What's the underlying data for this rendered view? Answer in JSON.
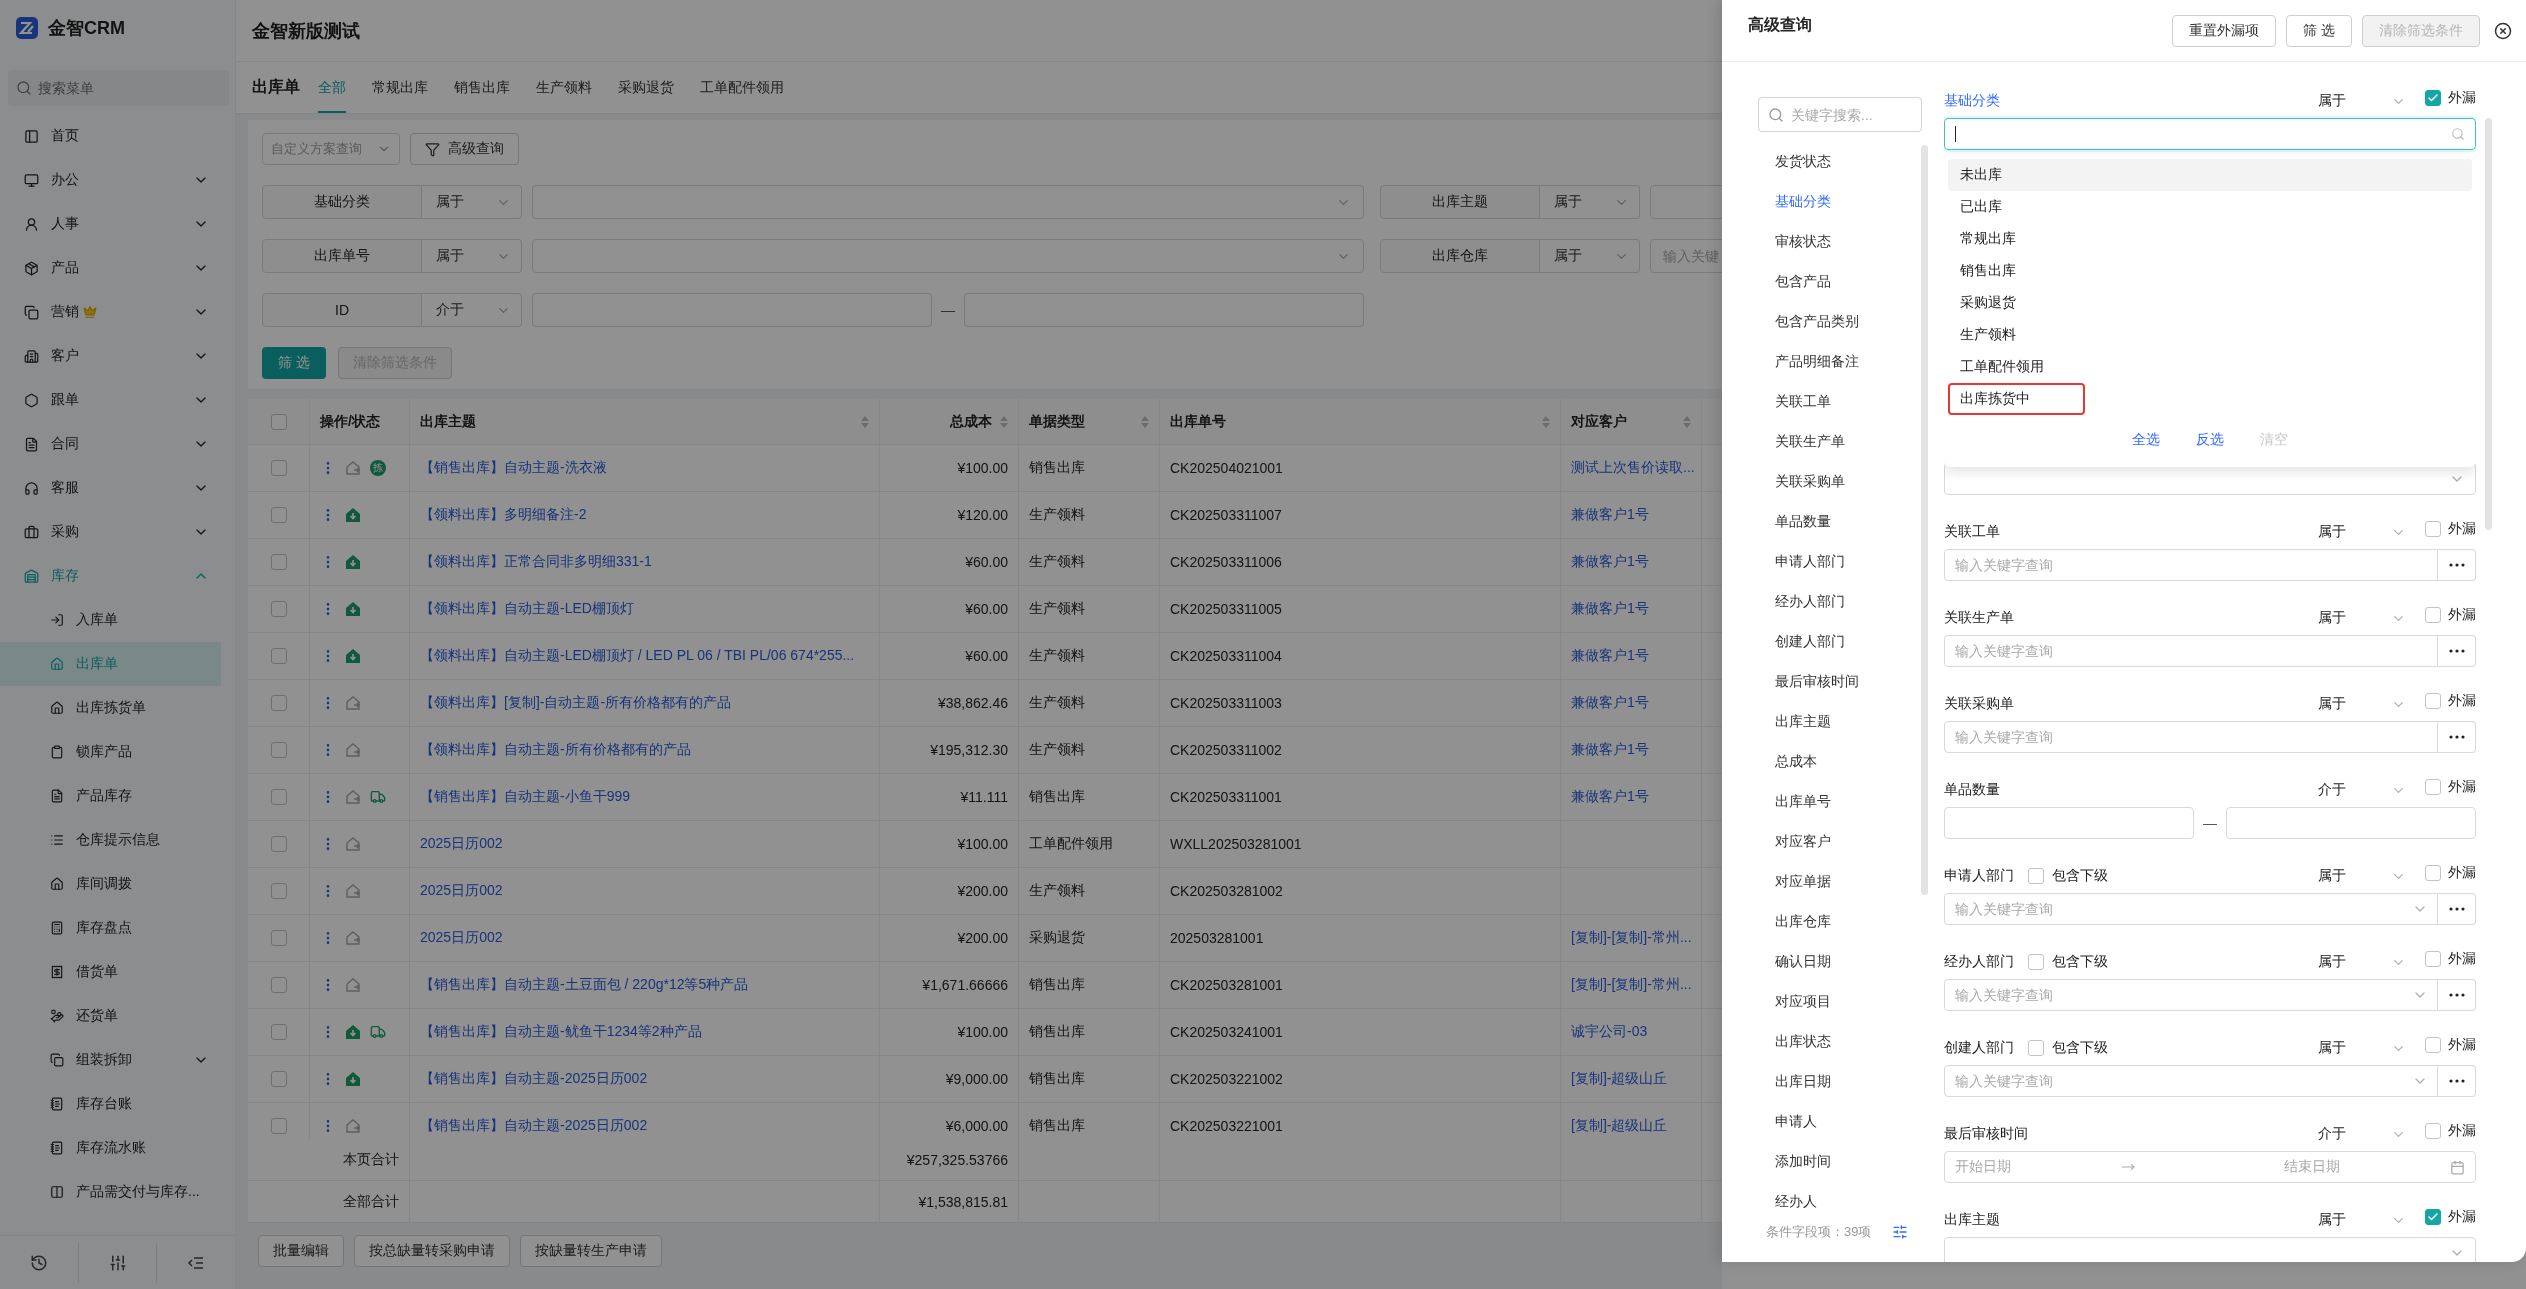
{
  "sidebar": {
    "brand": "金智CRM",
    "search_placeholder": "搜索菜单",
    "items": [
      {
        "label": "首页",
        "selected": false
      },
      {
        "label": "办公",
        "selected": false,
        "expanded": false
      },
      {
        "label": "人事",
        "selected": false,
        "expanded": false
      },
      {
        "label": "产品",
        "selected": false,
        "expanded": false
      },
      {
        "label": "营销",
        "selected": false,
        "expanded": false,
        "crown": true
      },
      {
        "label": "客户",
        "selected": false,
        "expanded": false
      },
      {
        "label": "跟单",
        "selected": false,
        "expanded": false
      },
      {
        "label": "合同",
        "selected": false,
        "expanded": false
      },
      {
        "label": "客服",
        "selected": false,
        "expanded": false
      },
      {
        "label": "采购",
        "selected": false,
        "expanded": false
      },
      {
        "label": "库存",
        "selected": true,
        "expanded": true,
        "children": [
          {
            "label": "入库单",
            "selected": false
          },
          {
            "label": "出库单",
            "selected": true
          },
          {
            "label": "出库拣货单",
            "selected": false
          },
          {
            "label": "锁库产品",
            "selected": false
          },
          {
            "label": "产品库存",
            "selected": false
          },
          {
            "label": "仓库提示信息",
            "selected": false
          },
          {
            "label": "库间调拨",
            "selected": false
          },
          {
            "label": "库存盘点",
            "selected": false
          },
          {
            "label": "借货单",
            "selected": false
          },
          {
            "label": "还货单",
            "selected": false
          },
          {
            "label": "组装拆卸",
            "selected": false,
            "expanded": false
          },
          {
            "label": "库存台账",
            "selected": false
          },
          {
            "label": "库存流水账",
            "selected": false
          },
          {
            "label": "产品需交付与库存...",
            "selected": false
          }
        ]
      }
    ]
  },
  "page": {
    "title": "金智新版测试"
  },
  "tabs": {
    "heading": "出库单",
    "items": [
      {
        "label": "全部",
        "selected": true
      },
      {
        "label": "常规出库",
        "selected": false
      },
      {
        "label": "销售出库",
        "selected": false
      },
      {
        "label": "生产领料",
        "selected": false
      },
      {
        "label": "采购退货",
        "selected": false
      },
      {
        "label": "工单配件领用",
        "selected": false
      }
    ]
  },
  "query": {
    "scheme_placeholder": "自定义方案查询",
    "advanced_button": "高级查询"
  },
  "filters": [
    {
      "label": "基础分类",
      "operator": "属于",
      "kind": "select"
    },
    {
      "label": "出库主题",
      "operator": "属于",
      "kind": "text"
    },
    {
      "label": "出库单号",
      "operator": "属于",
      "kind": "select"
    },
    {
      "label": "出库仓库",
      "operator": "属于",
      "kind": "text",
      "placeholder": "输入关键"
    },
    {
      "label": "ID",
      "operator": "介于",
      "kind": "range",
      "separator": "—"
    }
  ],
  "filter_actions": [
    {
      "label": "筛 选",
      "disabled": false
    },
    {
      "label": "清除筛选条件",
      "disabled": true
    }
  ],
  "table": {
    "all_checked": false,
    "columns": [
      {
        "label": "操作/状态",
        "sortable": false
      },
      {
        "label": "出库主题",
        "sortable": true
      },
      {
        "label": "总成本",
        "sortable": true
      },
      {
        "label": "单据类型",
        "sortable": true
      },
      {
        "label": "出库单号",
        "sortable": true
      },
      {
        "label": "对应客户",
        "sortable": true
      }
    ],
    "rows": [
      {
        "checked": false,
        "kind": "pending",
        "badge": "拣",
        "shipping": false,
        "subject": "【销售出库】自动主题-洗衣液",
        "cost": "¥100.00",
        "type": "销售出库",
        "number": "CK202504021001",
        "customer": "测试上次售价读取..."
      },
      {
        "checked": false,
        "kind": "done",
        "shipping": false,
        "subject": "【领料出库】多明细备注-2",
        "cost": "¥120.00",
        "type": "生产领料",
        "number": "CK202503311007",
        "customer": "兼做客户1号"
      },
      {
        "checked": false,
        "kind": "done",
        "shipping": false,
        "subject": "【领料出库】正常合同非多明细331-1",
        "cost": "¥60.00",
        "type": "生产领料",
        "number": "CK202503311006",
        "customer": "兼做客户1号"
      },
      {
        "checked": false,
        "kind": "done",
        "shipping": false,
        "subject": "【领料出库】自动主题-LED棚顶灯",
        "cost": "¥60.00",
        "type": "生产领料",
        "number": "CK202503311005",
        "customer": "兼做客户1号"
      },
      {
        "checked": false,
        "kind": "done",
        "shipping": false,
        "subject": "【领料出库】自动主题-LED棚顶灯 / LED PL 06 / TBI PL/06 674*255...",
        "cost": "¥60.00",
        "type": "生产领料",
        "number": "CK202503311004",
        "customer": "兼做客户1号"
      },
      {
        "checked": false,
        "kind": "pending",
        "shipping": false,
        "subject": "【领料出库】[复制]-自动主题-所有价格都有的产品",
        "cost": "¥38,862.46",
        "type": "生产领料",
        "number": "CK202503311003",
        "customer": "兼做客户1号"
      },
      {
        "checked": false,
        "kind": "pending",
        "shipping": false,
        "subject": "【领料出库】自动主题-所有价格都有的产品",
        "cost": "¥195,312.30",
        "type": "生产领料",
        "number": "CK202503311002",
        "customer": "兼做客户1号"
      },
      {
        "checked": false,
        "kind": "pending",
        "shipping": true,
        "subject": "【销售出库】自动主题-小鱼干999",
        "cost": "¥11.111",
        "type": "销售出库",
        "number": "CK202503311001",
        "customer": "兼做客户1号"
      },
      {
        "checked": false,
        "kind": "pending",
        "shipping": false,
        "subject": "2025日历002",
        "cost": "¥100.00",
        "type": "工单配件领用",
        "number": "WXLL202503281001"
      },
      {
        "checked": false,
        "kind": "pending",
        "shipping": false,
        "subject": "2025日历002",
        "cost": "¥200.00",
        "type": "生产领料",
        "number": "CK202503281002"
      },
      {
        "checked": false,
        "kind": "pending",
        "shipping": false,
        "subject": "2025日历002",
        "cost": "¥200.00",
        "type": "采购退货",
        "number": "202503281001",
        "customer": "[复制]-[复制]-常州..."
      },
      {
        "checked": false,
        "kind": "pending",
        "shipping": false,
        "subject": "【销售出库】自动主题-土豆面包 / 220g*12等5种产品",
        "cost": "¥1,671.66666",
        "type": "销售出库",
        "number": "CK202503281001",
        "customer": "[复制]-[复制]-常州..."
      },
      {
        "checked": false,
        "kind": "done",
        "shipping": true,
        "subject": "【销售出库】自动主题-鱿鱼干1234等2种产品",
        "cost": "¥100.00",
        "type": "销售出库",
        "number": "CK202503241001",
        "customer": "诚宇公司-03"
      },
      {
        "checked": false,
        "kind": "done",
        "shipping": false,
        "subject": "【销售出库】自动主题-2025日历002",
        "cost": "¥9,000.00",
        "type": "销售出库",
        "number": "CK202503221002",
        "customer": "[复制]-超级山丘"
      },
      {
        "checked": false,
        "kind": "pending",
        "shipping": false,
        "subject": "【销售出库】自动主题-2025日历002",
        "cost": "¥6,000.00",
        "type": "销售出库",
        "number": "CK202503221001",
        "customer": "[复制]-超级山丘"
      }
    ],
    "totals": [
      {
        "label": "本页合计",
        "cost": "¥257,325.53766"
      },
      {
        "label": "全部合计",
        "cost": "¥1,538,815.81"
      }
    ]
  },
  "bulk_actions": [
    "批量编辑",
    "按总缺量转采购申请",
    "按缺量转生产申请"
  ],
  "advanced_query": {
    "title": "高级查询",
    "buttons": [
      {
        "label": "重置外漏项",
        "disabled": false
      },
      {
        "label": "筛 选",
        "disabled": false
      },
      {
        "label": "清除筛选条件",
        "disabled": true
      }
    ],
    "field_search_placeholder": "关键字搜索...",
    "field_list": [
      {
        "label": "发货状态",
        "selected": false
      },
      {
        "label": "基础分类",
        "selected": true
      },
      {
        "label": "审核状态",
        "selected": false
      },
      {
        "label": "包含产品",
        "selected": false
      },
      {
        "label": "包含产品类别",
        "selected": false
      },
      {
        "label": "产品明细备注",
        "selected": false
      },
      {
        "label": "关联工单",
        "selected": false
      },
      {
        "label": "关联生产单",
        "selected": false
      },
      {
        "label": "关联采购单",
        "selected": false
      },
      {
        "label": "单品数量",
        "selected": false
      },
      {
        "label": "申请人部门",
        "selected": false
      },
      {
        "label": "经办人部门",
        "selected": false
      },
      {
        "label": "创建人部门",
        "selected": false
      },
      {
        "label": "最后审核时间",
        "selected": false
      },
      {
        "label": "出库主题",
        "selected": false
      },
      {
        "label": "总成本",
        "selected": false
      },
      {
        "label": "出库单号",
        "selected": false
      },
      {
        "label": "对应客户",
        "selected": false
      },
      {
        "label": "对应单据",
        "selected": false
      },
      {
        "label": "出库仓库",
        "selected": false
      },
      {
        "label": "确认日期",
        "selected": false
      },
      {
        "label": "对应项目",
        "selected": false
      },
      {
        "label": "出库状态",
        "selected": false
      },
      {
        "label": "出库日期",
        "selected": false
      },
      {
        "label": "申请人",
        "selected": false
      },
      {
        "label": "添加时间",
        "selected": false
      },
      {
        "label": "经办人",
        "selected": false
      }
    ],
    "field_count": "条件字段项：39项",
    "fields": [
      {
        "kind": "dropdown",
        "label": "基础分类",
        "active": true,
        "operator": "属于",
        "external_label": "外漏",
        "external": true,
        "options": [
          {
            "label": "未出库",
            "hovered": true,
            "outlined": false
          },
          {
            "label": "已出库",
            "hovered": false,
            "outlined": false
          },
          {
            "label": "常规出库",
            "hovered": false,
            "outlined": false
          },
          {
            "label": "销售出库",
            "hovered": false,
            "outlined": false
          },
          {
            "label": "采购退货",
            "hovered": false,
            "outlined": false
          },
          {
            "label": "生产领料",
            "hovered": false,
            "outlined": false
          },
          {
            "label": "工单配件领用",
            "hovered": false,
            "outlined": false
          },
          {
            "label": "出库拣货中",
            "hovered": false,
            "outlined": true
          }
        ],
        "actions": [
          {
            "label": "全选",
            "disabled": false
          },
          {
            "label": "反选",
            "disabled": false
          },
          {
            "label": "清空",
            "disabled": true
          }
        ]
      },
      {
        "kind": "select"
      },
      {
        "kind": "keyword",
        "label": "关联工单",
        "active": false,
        "operator": "属于",
        "external_label": "外漏",
        "external": false,
        "placeholder": "输入关键字查询"
      },
      {
        "kind": "keyword",
        "label": "关联生产单",
        "active": false,
        "operator": "属于",
        "external_label": "外漏",
        "external": false,
        "placeholder": "输入关键字查询"
      },
      {
        "kind": "keyword",
        "label": "关联采购单",
        "active": false,
        "operator": "属于",
        "external_label": "外漏",
        "external": false,
        "placeholder": "输入关键字查询"
      },
      {
        "kind": "range",
        "label": "单品数量",
        "active": false,
        "operator": "介于",
        "external_label": "外漏",
        "external": false,
        "separator": "—"
      },
      {
        "kind": "select-more",
        "label": "申请人部门",
        "active": false,
        "include_sub": {
          "label": "包含下级",
          "checked": false
        },
        "operator": "属于",
        "external_label": "外漏",
        "external": false,
        "placeholder": "输入关键字查询"
      },
      {
        "kind": "select-more",
        "label": "经办人部门",
        "active": false,
        "include_sub": {
          "label": "包含下级",
          "checked": false
        },
        "operator": "属于",
        "external_label": "外漏",
        "external": false,
        "placeholder": "输入关键字查询"
      },
      {
        "kind": "select-more",
        "label": "创建人部门",
        "active": false,
        "include_sub": {
          "label": "包含下级",
          "checked": false
        },
        "operator": "属于",
        "external_label": "外漏",
        "external": false,
        "placeholder": "输入关键字查询"
      },
      {
        "kind": "date-range",
        "label": "最后审核时间",
        "active": false,
        "operator": "介于",
        "external_label": "外漏",
        "external": false,
        "start_placeholder": "开始日期",
        "end_placeholder": "结束日期"
      },
      {
        "kind": "select",
        "label": "出库主题",
        "active": false,
        "operator": "属于",
        "external_label": "外漏",
        "external": true
      }
    ]
  }
}
